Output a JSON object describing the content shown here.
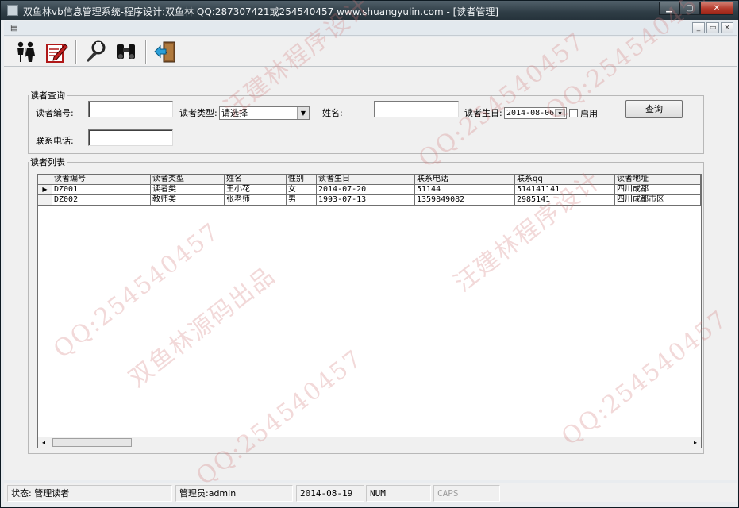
{
  "window": {
    "title": "双鱼林vb信息管理系统-程序设计:双鱼林 QQ:287307421或254540457 www.shuangyulin.com - [读者管理]",
    "controls": {
      "minimize": "▁",
      "maximize": "▢",
      "close": "✕"
    }
  },
  "mdi": {
    "icon": "▤",
    "min": "_",
    "restore": "▭",
    "close": "×"
  },
  "toolbar": {
    "items": [
      {
        "name": "reader-manage-icon"
      },
      {
        "name": "edit-form-icon"
      },
      {
        "name": "settings-tools-icon"
      },
      {
        "name": "binoculars-icon"
      },
      {
        "name": "exit-door-icon"
      }
    ]
  },
  "query": {
    "legend": "读者查询",
    "reader_no_label": "读者编号:",
    "reader_no_value": "",
    "reader_type_label": "读者类型:",
    "reader_type_value": "请选择",
    "name_label": "姓名:",
    "name_value": "",
    "birthday_label": "读者生日:",
    "birthday_value": "2014-08-06",
    "enable_label": "启用",
    "phone_label": "联系电话:",
    "phone_value": "",
    "search_button": "查询"
  },
  "list": {
    "legend": "读者列表",
    "columns": [
      "读者编号",
      "读者类型",
      "姓名",
      "性别",
      "读者生日",
      "联系电话",
      "联系qq",
      "读者地址"
    ],
    "rows": [
      [
        "DZ001",
        "读者类",
        "王小花",
        "女",
        "2014-07-20",
        "51144",
        "514141141",
        "四川成都"
      ],
      [
        "DZ002",
        "教师类",
        "张老师",
        "男",
        "1993-07-13",
        "1359849082",
        "2985141",
        "四川成都市区"
      ]
    ],
    "current_row_marker": "▶",
    "scroll_left": "◂",
    "scroll_right": "▸"
  },
  "status": {
    "state": "状态: 管理读者",
    "admin": "管理员:admin",
    "date": "2014-08-19",
    "num": "NUM",
    "caps": "CAPS"
  },
  "watermarks": [
    "QQ:254540457",
    "汪建林程序设计",
    "双鱼林源码出品"
  ]
}
